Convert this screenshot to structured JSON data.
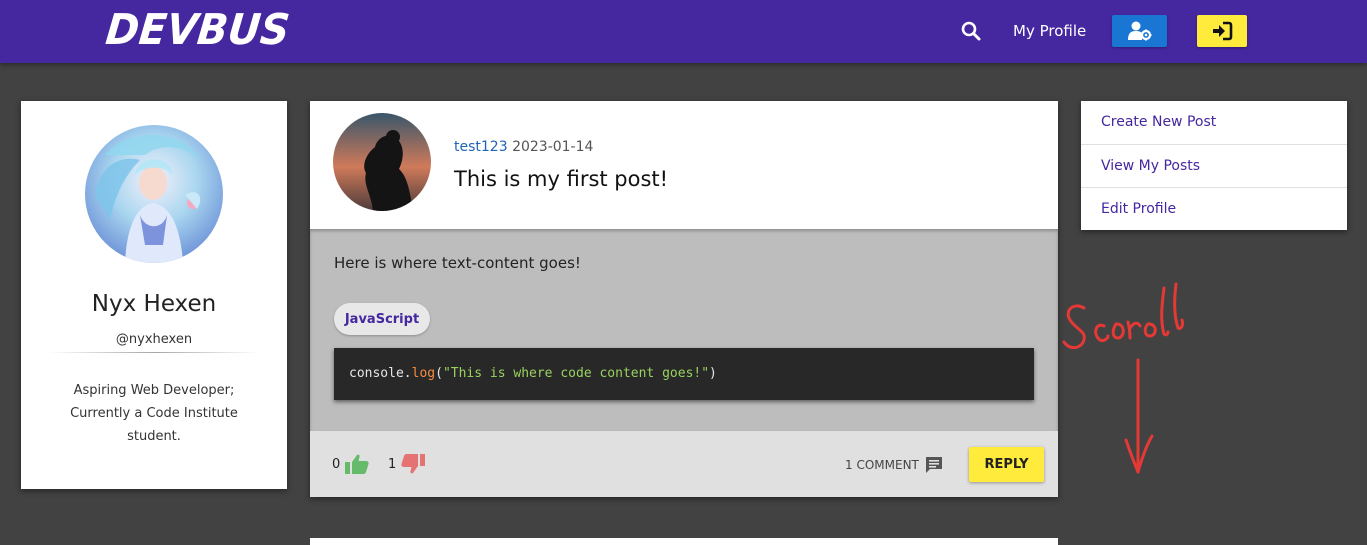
{
  "header": {
    "logo": "DEVBUS",
    "search_icon": "search-icon",
    "my_profile_label": "My Profile",
    "profile_settings_icon": "user-cog-icon",
    "sign_in_icon": "sign-in-icon",
    "colors": {
      "bar": "#4527a0",
      "blue_button": "#1976d2",
      "yellow_button": "#ffeb3b"
    }
  },
  "profile": {
    "name": "Nyx Hexen",
    "handle": "@nyxhexen",
    "bio": "Aspiring Web Developer; Currently a Code Institute student."
  },
  "post": {
    "author": "test123",
    "date": "2023-01-14",
    "title": "This is my first post!",
    "text": "Here is where text-content goes!",
    "tag": "JavaScript",
    "code": {
      "object": "console.",
      "method": "log",
      "open": "(",
      "string": "\"This is where code content goes!\"",
      "close": ")"
    },
    "likes": "0",
    "dislikes": "1",
    "comments": "1 COMMENT",
    "reply_label": "REPLY",
    "icons": {
      "like": "thumbs-up-icon",
      "dislike": "thumbs-down-icon",
      "comment": "comment-icon"
    },
    "colors": {
      "like": "#66bb6a",
      "dislike": "#e57373"
    }
  },
  "menu": {
    "items": [
      {
        "label": "Create New Post"
      },
      {
        "label": "View My Posts"
      },
      {
        "label": "Edit Profile"
      }
    ]
  },
  "annotation": {
    "text": "Scroll",
    "color": "#e53935"
  }
}
